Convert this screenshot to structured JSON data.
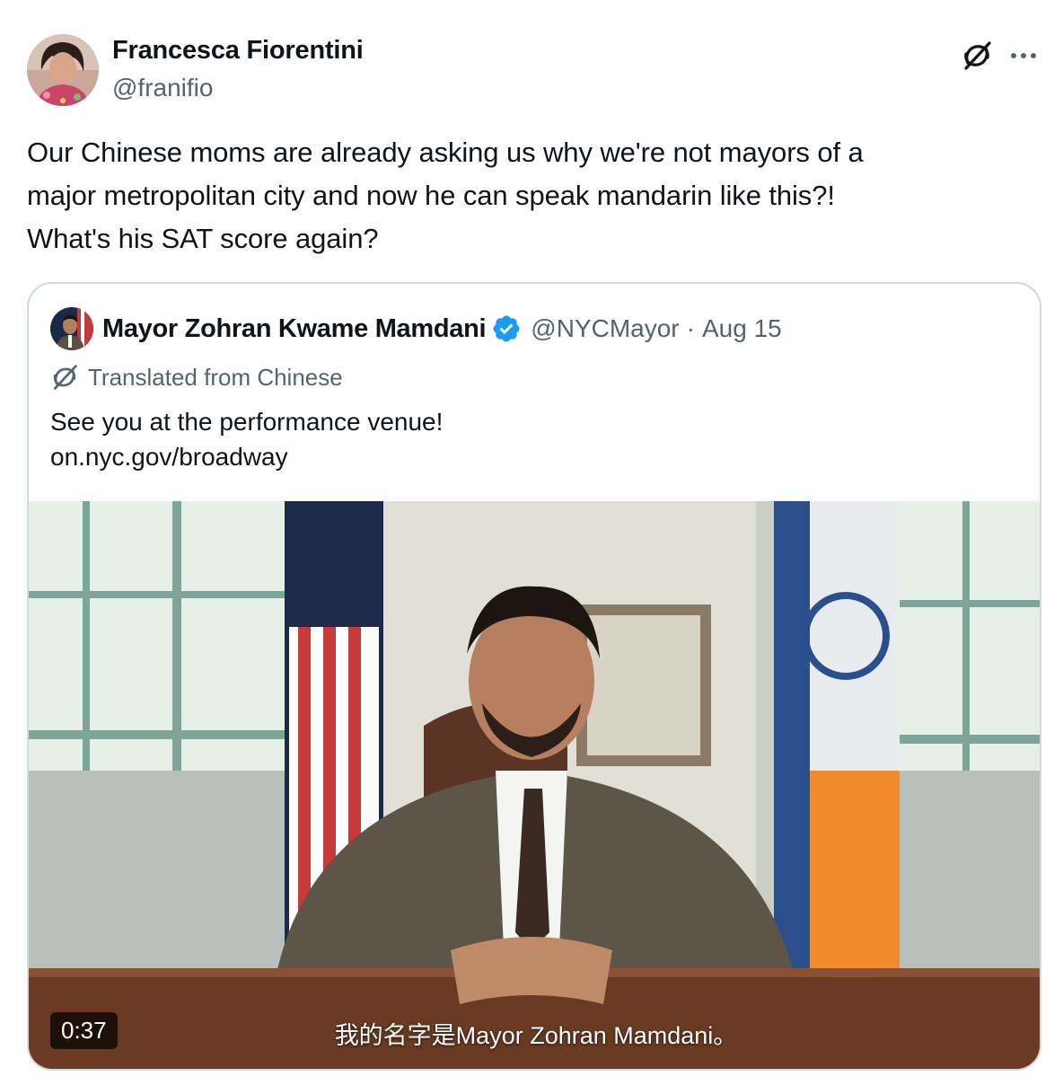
{
  "post": {
    "author_name": "Francesca Fiorentini",
    "author_handle": "@franifio",
    "text": "Our Chinese moms are already asking us why we're not mayors of a\nmajor metropolitan city and now he can speak mandarin like this?!\nWhat's his SAT score again?",
    "icons": {
      "grok": "grok-icon",
      "more": "more-icon"
    }
  },
  "quote": {
    "author_name": "Mayor Zohran Kwame Mamdani",
    "author_handle": "@NYCMayor",
    "separator": "·",
    "date": "Aug 15",
    "verified": true,
    "translated_label": "Translated from Chinese",
    "text": "See you at the performance venue!",
    "link": "on.nyc.gov/broadway",
    "video": {
      "duration": "0:37",
      "caption": "我的名字是Mayor Zohran Mamdani。"
    }
  },
  "colors": {
    "text_primary": "#0f1419",
    "text_secondary": "#536471",
    "border": "#cfd9de",
    "verified_blue": "#1d9bf0"
  }
}
